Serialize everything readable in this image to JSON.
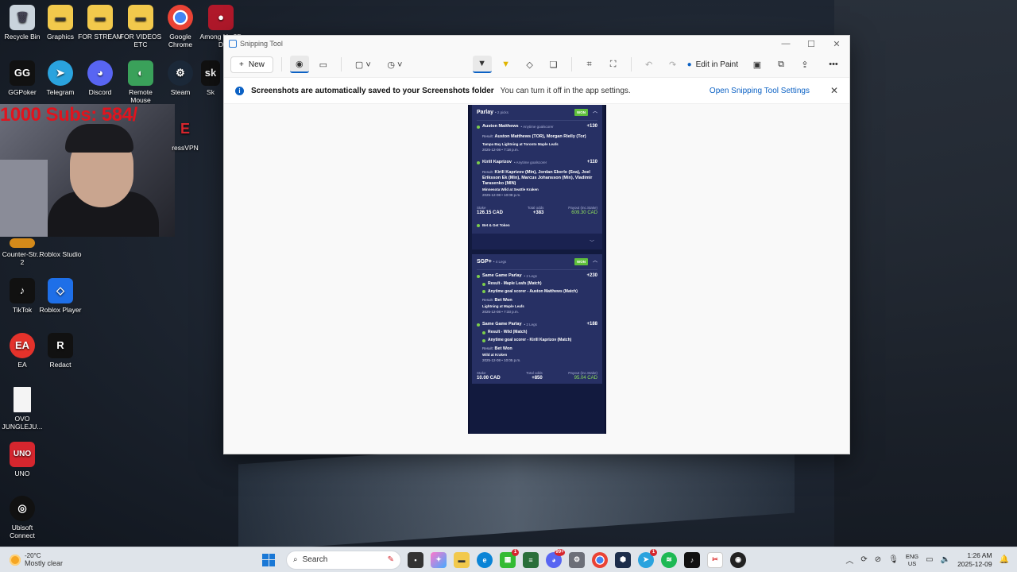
{
  "desktop": {
    "icons": [
      {
        "label": "Recycle Bin",
        "icon": "recycle-bin-icon"
      },
      {
        "label": "Graphics",
        "icon": "folder-icon"
      },
      {
        "label": "FOR STREAM",
        "icon": "folder-icon"
      },
      {
        "label": "FOR VIDEOS ETC",
        "icon": "folder-icon"
      },
      {
        "label": "Google Chrome",
        "icon": "chrome-icon"
      },
      {
        "label": "Among Us 3D D",
        "icon": "among-us-icon"
      },
      {
        "label": "GGPoker",
        "icon": "ggpoker-icon"
      },
      {
        "label": "Telegram",
        "icon": "telegram-icon"
      },
      {
        "label": "Discord",
        "icon": "discord-icon"
      },
      {
        "label": "Remote Mouse",
        "icon": "remote-mouse-icon"
      },
      {
        "label": "Steam",
        "icon": "steam-icon"
      },
      {
        "label": "Sk",
        "icon": "skype-icon"
      },
      {
        "label": "ressVPN",
        "icon": "expressvpn-icon"
      },
      {
        "label": "Counter-Str... 2",
        "icon": "counter-strike-icon"
      },
      {
        "label": "Roblox Studio",
        "icon": "roblox-studio-icon"
      },
      {
        "label": "TikTok",
        "icon": "tiktok-icon"
      },
      {
        "label": "Roblox Player",
        "icon": "roblox-player-icon"
      },
      {
        "label": "EA",
        "icon": "ea-icon"
      },
      {
        "label": "Redact",
        "icon": "redact-icon"
      },
      {
        "label": "OVO JUNGLEJU...",
        "icon": "document-icon"
      },
      {
        "label": "UNO",
        "icon": "uno-icon"
      },
      {
        "label": "Ubisoft Connect",
        "icon": "ubisoft-icon"
      }
    ],
    "stream_overlay": "1000  Subs: 584/"
  },
  "window": {
    "title": "Snipping Tool",
    "new_label": "New",
    "edit_in_paint": "Edit in Paint",
    "notice_bold": "Screenshots are automatically saved to your Screenshots folder",
    "notice_msg": "You can turn it off in the app settings.",
    "notice_link": "Open Snipping Tool Settings"
  },
  "bet1": {
    "title": "Parlay",
    "sub": "• 2 picks",
    "status": "WON",
    "legs": [
      {
        "name": "Auston Matthews",
        "tag": "• Anytime goalscorer",
        "odds": "+130",
        "result_label": "Result:",
        "result": "Auston Matthews (TOR), Morgan Rielly (Tor)",
        "match": "Tampa Bay Lightning at Toronto Maple Leafs",
        "date": "2025-12-08 • 7:18 p.m."
      },
      {
        "name": "Kirill Kaprizov",
        "tag": "• Anytime goalscorer",
        "odds": "+110",
        "result_label": "Result:",
        "result": "Kirill Kaprizov (Min), Jordan Eberle (Sea), Joel Eriksson Ek (Min), Marcus Johansson (Min), Vladimir Tarasenko (MIN)",
        "match": "Minnesota Wild at Seattle Kraken",
        "date": "2025-12-08 • 10:08 p.m."
      }
    ],
    "stake_label": "Stake",
    "stake": "126.15 CAD",
    "odds_label": "Total odds",
    "total_odds": "+383",
    "payout_label": "Payout (inc.Stake)",
    "payout": "609.30 CAD",
    "token": "Bet & Get Token"
  },
  "bet2": {
    "title": "SGP+",
    "sub": "• 4 Legs",
    "status": "WON",
    "groups": [
      {
        "name": "Same Game Parlay",
        "tag": "• 2 Legs",
        "odds": "+230",
        "legs": [
          "Result - Maple Leafs (Match)",
          "Anytime goal scorer - Auston Matthews (Match)"
        ],
        "result_label": "Result:",
        "result": "Bet Won",
        "match": "Lightning at Maple Leafs",
        "date": "2025-12-08 • 7:33 p.m."
      },
      {
        "name": "Same Game Parlay",
        "tag": "• 2 Legs",
        "odds": "+188",
        "legs": [
          "Result - Wild (Match)",
          "Anytime goal scorer - Kirill Kaprizov (Match)"
        ],
        "result_label": "Result:",
        "result": "Bet Won",
        "match": "Wild at Kraken",
        "date": "2025-12-08 • 10:05 p.m."
      }
    ],
    "stake_label": "Stake",
    "stake": "10.00 CAD",
    "odds_label": "Total odds",
    "total_odds": "+850",
    "payout_label": "Payout (inc.Stake)",
    "payout": "95.04 CAD"
  },
  "taskbar": {
    "temp": "-20°C",
    "weather": "Mostly clear",
    "search_placeholder": "Search",
    "lang1": "ENG",
    "lang2": "US",
    "time": "1:26 AM",
    "date": "2025-12-09",
    "badges": [
      "1",
      "99+",
      "1"
    ]
  },
  "colors": {
    "accent": "#0b61c4",
    "won": "#5fbf3c",
    "payout": "#8fe05c",
    "card": "#273064"
  }
}
